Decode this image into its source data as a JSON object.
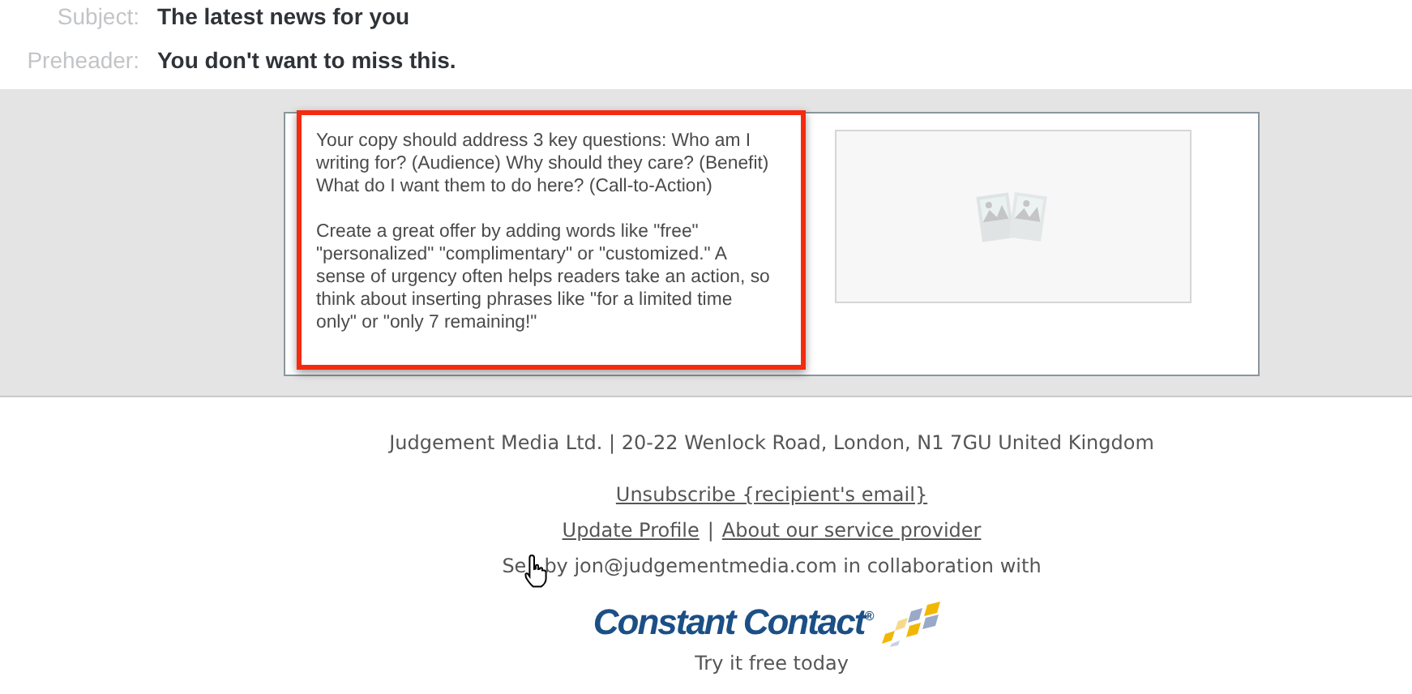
{
  "header_fields": [
    {
      "label": "Subject:",
      "value": "The latest news for you"
    },
    {
      "label": "Preheader:",
      "value": "You don't want to miss this."
    }
  ],
  "content_block": {
    "text_box": {
      "selected": true,
      "paragraphs": [
        "Your copy should address 3 key questions: Who am I writing for? (Audience) Why should they care? (Benefit) What do I want them to do here? (Call-to-Action)",
        "Create a great offer by adding words like \"free\" \"personalized\" \"complimentary\" or \"customized.\" A sense of urgency often helps readers take an action, so think about inserting phrases like \"for a limited time only\" or \"only 7 remaining!\""
      ]
    },
    "image": {
      "kind": "placeholder"
    }
  },
  "footer": {
    "address": "Judgement Media Ltd. | 20-22 Wenlock Road, London, N1 7GU United Kingdom",
    "unsubscribe_link": "Unsubscribe {recipient's email}",
    "links": [
      "Update Profile",
      "About our service provider"
    ],
    "separator": "|",
    "sent_by": [
      "Se",
      "by jon@judgementmedia.com in collaboration with"
    ],
    "logo": {
      "name": "Constant Contact",
      "mark": "®"
    },
    "tagline": "Try it free today"
  }
}
